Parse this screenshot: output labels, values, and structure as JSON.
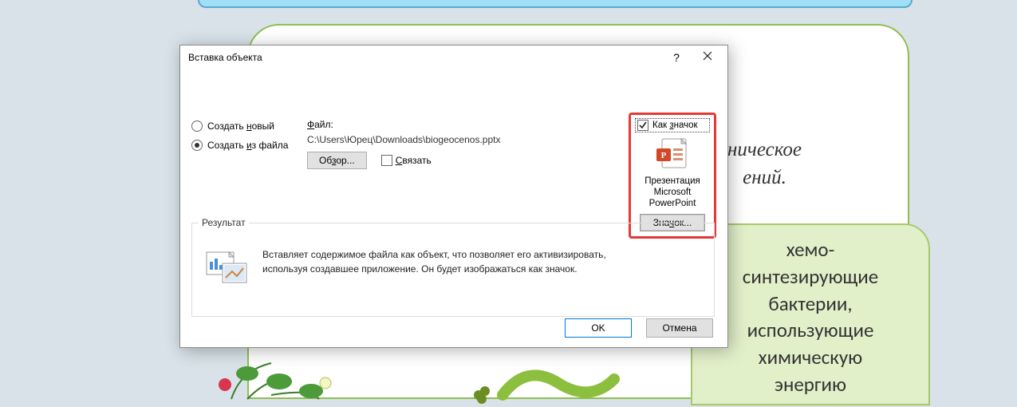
{
  "background": {
    "text_right": "ническое\nений.",
    "bubble_text": "хемо-\nсинтезирующие\nбактерии,\nиспользующие\nхимическую\nэнергию"
  },
  "dialog": {
    "title": "Вставка объекта",
    "help": "?",
    "close": "×",
    "radio": {
      "new_prefix": "Создать",
      "new_ul": "н",
      "new_suffix": "овый",
      "file_prefix": "Создать",
      "file_ul": "и",
      "file_suffix": "з файла"
    },
    "file": {
      "label_ul": "Ф",
      "label_suffix": "айл:",
      "path": "C:\\Users\\Юрец\\Downloads\\biogeocenos.pptx",
      "browse_prefix": "Об",
      "browse_ul": "з",
      "browse_suffix": "ор...",
      "link_ul": "С",
      "link_suffix": "вязать"
    },
    "iconpanel": {
      "asicon_prefix": "Как",
      "asicon_ul": "з",
      "asicon_suffix": "начок",
      "caption": "Презентация Microsoft PowerPoint",
      "select_prefix": "Зна",
      "select_ul": "ч",
      "select_suffix": "ок..."
    },
    "group": {
      "title": "Результат",
      "text": "Вставляет содержимое файла как объект, что позволяет его активизировать, используя создавшее приложение. Он будет изображаться как значок."
    },
    "buttons": {
      "ok": "OK",
      "cancel": "Отмена"
    }
  }
}
